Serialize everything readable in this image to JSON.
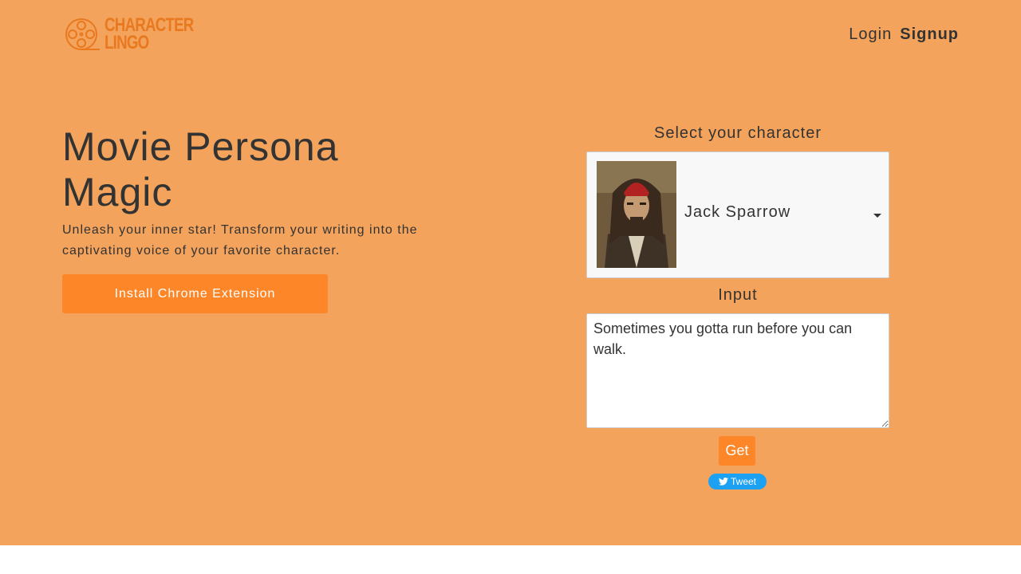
{
  "header": {
    "logo_line1": "CHARACTER",
    "logo_line2": "LINGO",
    "nav": {
      "login": "Login",
      "signup": "Signup"
    }
  },
  "hero": {
    "headline": "Movie Persona Magic",
    "tagline": "Unleash your inner star! Transform your writing into the captivating voice of your favorite character.",
    "install_label": "Install Chrome Extension"
  },
  "form": {
    "select_label": "Select your character",
    "selected_character": "Jack Sparrow",
    "input_label": "Input",
    "input_value": "Sometimes you gotta run before you can walk.",
    "get_label": "Get",
    "tweet_label": "Tweet"
  },
  "colors": {
    "hero_background": "#f3a35c",
    "accent": "#fd8628",
    "logo": "#e8791f",
    "tweet": "#1da1f2",
    "text": "#333333"
  },
  "icons": {
    "logo": "film-reel-icon",
    "select_caret": "caret-down-icon",
    "tweet": "twitter-bird-icon"
  }
}
